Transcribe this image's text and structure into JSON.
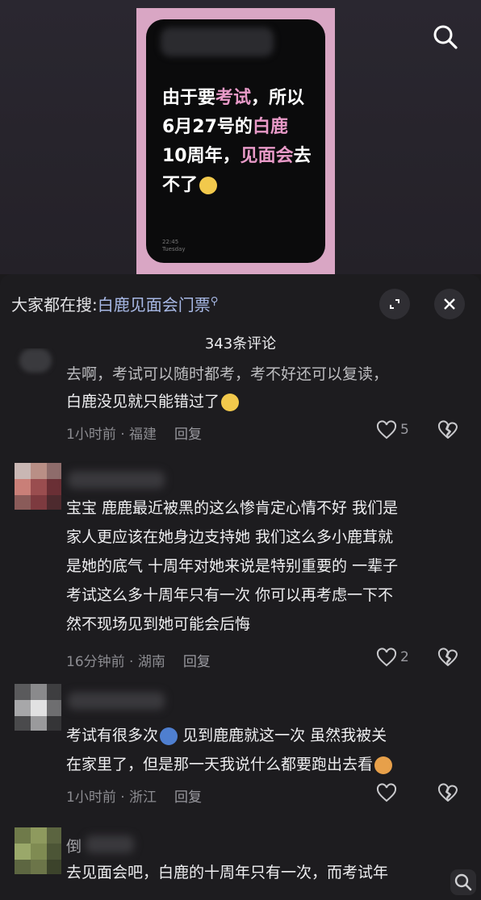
{
  "post": {
    "message_parts": [
      "由于要",
      "考试",
      "，所以6月27号的",
      "白鹿",
      "10周年，",
      "见面会",
      "去不了"
    ],
    "time": "22:45",
    "day": "Tuesday"
  },
  "search_bar": {
    "prefix": "大家都在搜:",
    "query": "白鹿见面会门票"
  },
  "comments_header": {
    "count_label": "343条评论"
  },
  "comments": [
    {
      "lines": [
        "去啊，考试可以随时都考，考不好还可以复读，",
        "白鹿没见就只能错过了"
      ],
      "time": "1小时前",
      "location": "福建",
      "reply": "回复",
      "likes": "5"
    },
    {
      "lines": [
        "宝宝 鹿鹿最近被黑的这么惨肯定心情不好 我们是",
        "家人更应该在她身边支持她 我们这么多小鹿茸就",
        "是她的底气 十周年对她来说是特别重要的 一辈子",
        "考试这么多十周年只有一次  你可以再考虑一下不",
        "然不现场见到她可能会后悔"
      ],
      "time": "16分钟前",
      "location": "湖南",
      "reply": "回复",
      "likes": "2"
    },
    {
      "lines": [
        "考试有很多次",
        "见到鹿鹿就这一次 虽然我被关",
        "在家里了，但是那一天我说什么都要跑出去看"
      ],
      "time": "1小时前",
      "location": "浙江",
      "reply": "回复",
      "likes": ""
    },
    {
      "username_visible": "倒",
      "lines": [
        "去见面会吧，白鹿的十周年只有一次，而考试年"
      ]
    }
  ],
  "colors": {
    "accent_pink": "#e89ac8",
    "link_blue": "#a8b9e6",
    "sheet_bg": "#1d1c1f"
  }
}
